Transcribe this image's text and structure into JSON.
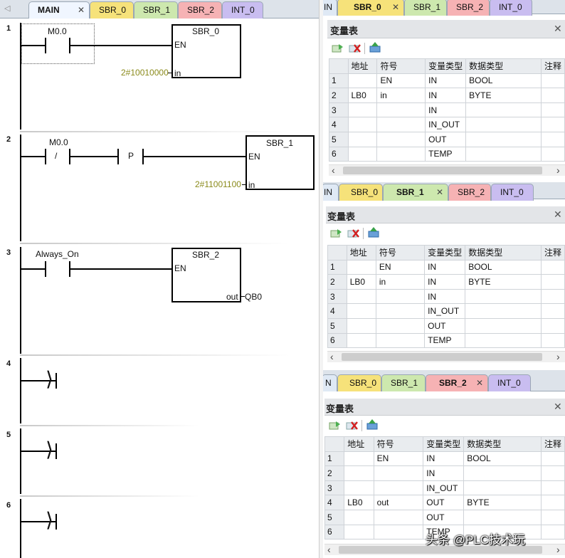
{
  "editor": {
    "tabs": [
      {
        "label": "MAIN",
        "close": "✕"
      },
      {
        "label": "SBR_0"
      },
      {
        "label": "SBR_1"
      },
      {
        "label": "SBR_2"
      },
      {
        "label": "INT_0"
      }
    ],
    "networks": [
      {
        "number": "1",
        "contact": "M0.0",
        "block": "SBR_0",
        "en": "EN",
        "param_value": "2#10010000",
        "param_name": "in"
      },
      {
        "number": "2",
        "contact": "M0.0",
        "contact_symbol": "/",
        "edge_symbol": "P",
        "block": "SBR_1",
        "en": "EN",
        "param_value": "2#11001100",
        "param_name": "in"
      },
      {
        "number": "3",
        "contact": "Always_On",
        "block": "SBR_2",
        "en": "EN",
        "out_name": "out",
        "out_value": "QB0"
      },
      {
        "number": "4"
      },
      {
        "number": "5"
      },
      {
        "number": "6"
      }
    ]
  },
  "panels": [
    {
      "tabs": [
        "IN",
        "SBR_0",
        "SBR_1",
        "SBR_2",
        "INT_0"
      ],
      "active_tab": "SBR_0",
      "title": "变量表",
      "close": "✕",
      "headers": [
        "",
        "地址",
        "符号",
        "变量类型",
        "数据类型",
        "注释"
      ],
      "rows": [
        [
          "1",
          "",
          "EN",
          "IN",
          "BOOL",
          ""
        ],
        [
          "2",
          "LB0",
          "in",
          "IN",
          "BYTE",
          ""
        ],
        [
          "3",
          "",
          "",
          "IN",
          "",
          ""
        ],
        [
          "4",
          "",
          "",
          "IN_OUT",
          "",
          ""
        ],
        [
          "5",
          "",
          "",
          "OUT",
          "",
          ""
        ],
        [
          "6",
          "",
          "",
          "TEMP",
          "",
          ""
        ]
      ]
    },
    {
      "tabs": [
        "IN",
        "SBR_0",
        "SBR_1",
        "SBR_2",
        "INT_0"
      ],
      "active_tab": "SBR_1",
      "title": "变量表",
      "close": "✕",
      "headers": [
        "",
        "地址",
        "符号",
        "变量类型",
        "数据类型",
        "注释"
      ],
      "rows": [
        [
          "1",
          "",
          "EN",
          "IN",
          "BOOL",
          ""
        ],
        [
          "2",
          "LB0",
          "in",
          "IN",
          "BYTE",
          ""
        ],
        [
          "3",
          "",
          "",
          "IN",
          "",
          ""
        ],
        [
          "4",
          "",
          "",
          "IN_OUT",
          "",
          ""
        ],
        [
          "5",
          "",
          "",
          "OUT",
          "",
          ""
        ],
        [
          "6",
          "",
          "",
          "TEMP",
          "",
          ""
        ]
      ]
    },
    {
      "tabs": [
        "N",
        "SBR_0",
        "SBR_1",
        "SBR_2",
        "INT_0"
      ],
      "active_tab": "SBR_2",
      "title": "变量表",
      "close": "✕",
      "headers": [
        "",
        "地址",
        "符号",
        "变量类型",
        "数据类型",
        "注释"
      ],
      "rows": [
        [
          "1",
          "",
          "EN",
          "IN",
          "BOOL",
          ""
        ],
        [
          "2",
          "",
          "",
          "IN",
          "",
          ""
        ],
        [
          "3",
          "",
          "",
          "IN_OUT",
          "",
          ""
        ],
        [
          "4",
          "LB0",
          "out",
          "OUT",
          "BYTE",
          ""
        ],
        [
          "5",
          "",
          "",
          "OUT",
          "",
          ""
        ],
        [
          "6",
          "",
          "",
          "TEMP",
          "",
          ""
        ]
      ]
    }
  ],
  "watermark": "头条 @PLC技术玩"
}
